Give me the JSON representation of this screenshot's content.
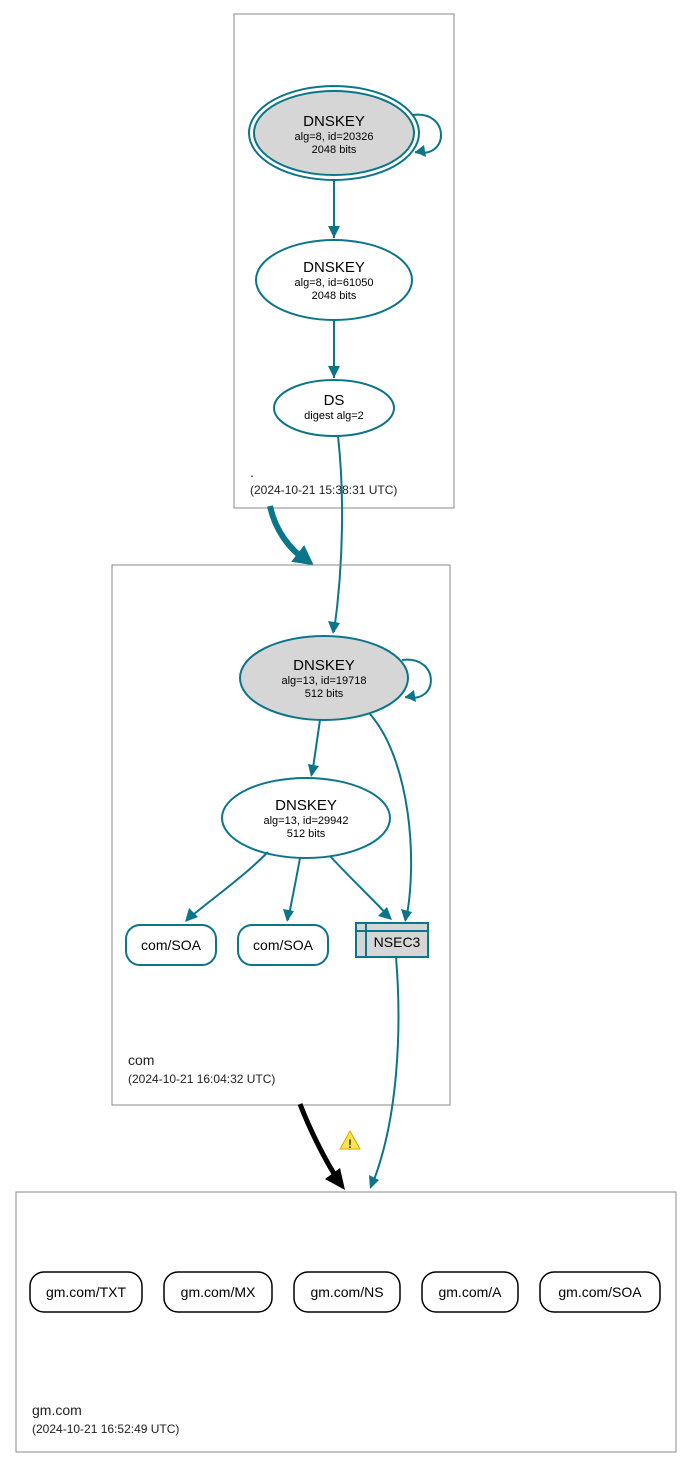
{
  "zones": {
    "root": {
      "label": ".",
      "date": "(2024-10-21 15:38:31 UTC)"
    },
    "com": {
      "label": "com",
      "date": "(2024-10-21 16:04:32 UTC)"
    },
    "gm": {
      "label": "gm.com",
      "date": "(2024-10-21 16:52:49 UTC)"
    }
  },
  "nodes": {
    "root_ksk": {
      "title": "DNSKEY",
      "line2": "alg=8, id=20326",
      "line3": "2048 bits"
    },
    "root_zsk": {
      "title": "DNSKEY",
      "line2": "alg=8, id=61050",
      "line3": "2048 bits"
    },
    "root_ds": {
      "title": "DS",
      "line2": "digest alg=2"
    },
    "com_ksk": {
      "title": "DNSKEY",
      "line2": "alg=13, id=19718",
      "line3": "512 bits"
    },
    "com_zsk": {
      "title": "DNSKEY",
      "line2": "alg=13, id=29942",
      "line3": "512 bits"
    },
    "com_soa1": {
      "label": "com/SOA"
    },
    "com_soa2": {
      "label": "com/SOA"
    },
    "nsec3": {
      "label": "NSEC3"
    },
    "gm_txt": {
      "label": "gm.com/TXT"
    },
    "gm_mx": {
      "label": "gm.com/MX"
    },
    "gm_ns": {
      "label": "gm.com/NS"
    },
    "gm_a": {
      "label": "gm.com/A"
    },
    "gm_soa": {
      "label": "gm.com/SOA"
    }
  },
  "colors": {
    "teal": "#0b7589",
    "grey": "#d6d6d6"
  }
}
